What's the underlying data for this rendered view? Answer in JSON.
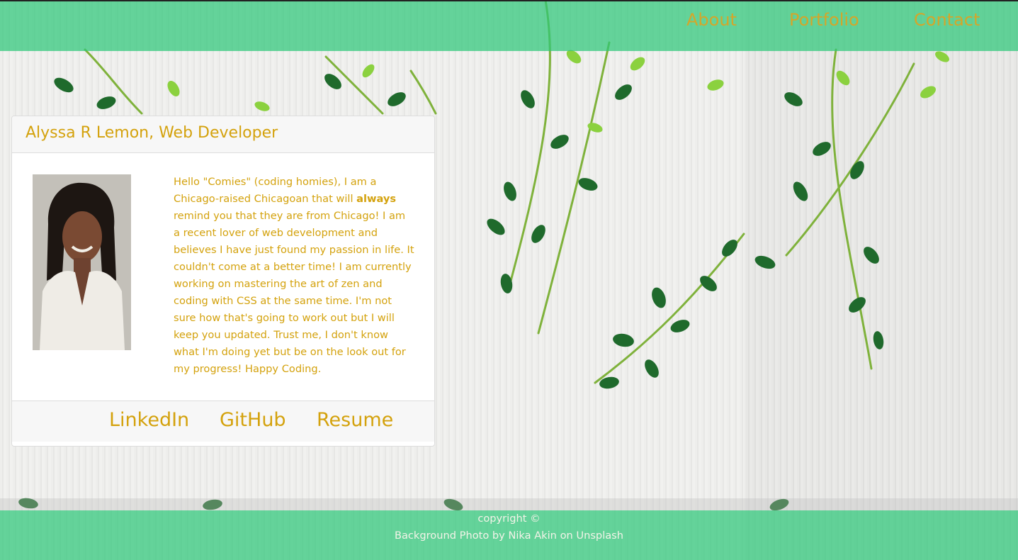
{
  "nav": {
    "about": "About",
    "portfolio": "Portfolio",
    "contact": "Contact"
  },
  "card": {
    "title": "Alyssa R Lemon, Web Developer",
    "bio_part1": "Hello \"Comies\" (coding homies), I am a Chicago-raised Chicagoan that will ",
    "bio_bold": "always",
    "bio_part2": " remind you that they are from Chicago! I am a recent lover of web development and believes I have just found my passion in life. It couldn't come at a better time! I am currently working on mastering the art of zen and coding with CSS at the same time. I'm not sure how that's going to work out but I will keep you updated. Trust me, I don't know what I'm doing yet but be on the look out for my progress! Happy Coding.",
    "links": {
      "linkedin": "LinkedIn",
      "github": "GitHub",
      "resume": "Resume"
    }
  },
  "footer": {
    "copyright": "copyright ©",
    "credit": "Background Photo by Nika Akin on Unsplash"
  },
  "colors": {
    "accent": "#d4a20d",
    "header_green": "#2ec878",
    "leaf_dark": "#1e5f2a",
    "leaf_light": "#7cc23a"
  }
}
